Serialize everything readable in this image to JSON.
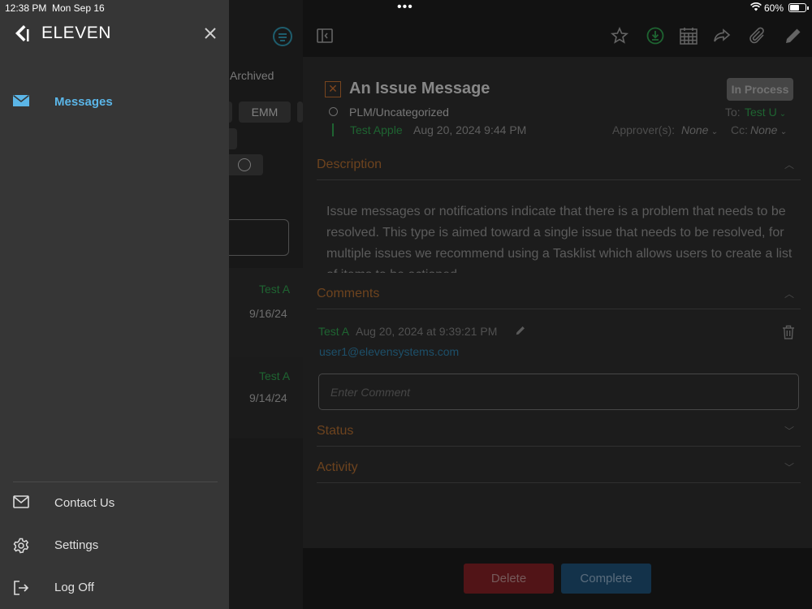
{
  "status_bar": {
    "time": "12:38 PM",
    "date": "Mon Sep 16",
    "battery": "60%"
  },
  "menu": {
    "brand": "ELEVEN",
    "items": [
      {
        "label": "Messages",
        "icon": "envelope-icon",
        "active": true
      }
    ],
    "bottom_items": [
      {
        "label": "Contact Us",
        "icon": "mail-icon"
      },
      {
        "label": "Settings",
        "icon": "gear-icon"
      },
      {
        "label": "Log Off",
        "icon": "logout-icon"
      }
    ]
  },
  "list": {
    "tab_archived": "Archived",
    "chip_label": "EMM",
    "rows": [
      {
        "sender": "Test A",
        "date": "9/16/24"
      },
      {
        "sender": "Test A",
        "date": "9/14/24"
      }
    ]
  },
  "message": {
    "title": "An Issue Message",
    "status": "In Process",
    "category": "PLM/Uncategorized",
    "to_label": "To:",
    "to_value": "Test U",
    "sender": "Test Apple",
    "sent_date": "Aug 20, 2024 9:44 PM",
    "approver_label": "Approver(s):",
    "approver_value": "None",
    "cc_label": "Cc:",
    "cc_value": "None",
    "description_heading": "Description",
    "description_text": "Issue messages or notifications indicate that there is a problem that needs to be resolved. This type is aimed toward a single issue that needs to be resolved, for multiple issues we recommend using a Tasklist which allows users to create a list of items to be actioned.",
    "comments_heading": "Comments",
    "comment": {
      "sender": "Test A",
      "date": "Aug 20, 2024 at 9:39:21 PM",
      "email": "user1@elevensystems.com"
    },
    "comment_placeholder": "Enter Comment",
    "status_heading": "Status",
    "activity_heading": "Activity"
  },
  "footer": {
    "delete_label": "Delete",
    "complete_label": "Complete"
  },
  "colors": {
    "accent_green": "#2e9a4c",
    "section_orange": "#a8672e",
    "link_blue": "#2d7aa2",
    "menu_active": "#5bb6e8",
    "delete_red": "#7d2024",
    "complete_blue": "#1e4d72"
  }
}
